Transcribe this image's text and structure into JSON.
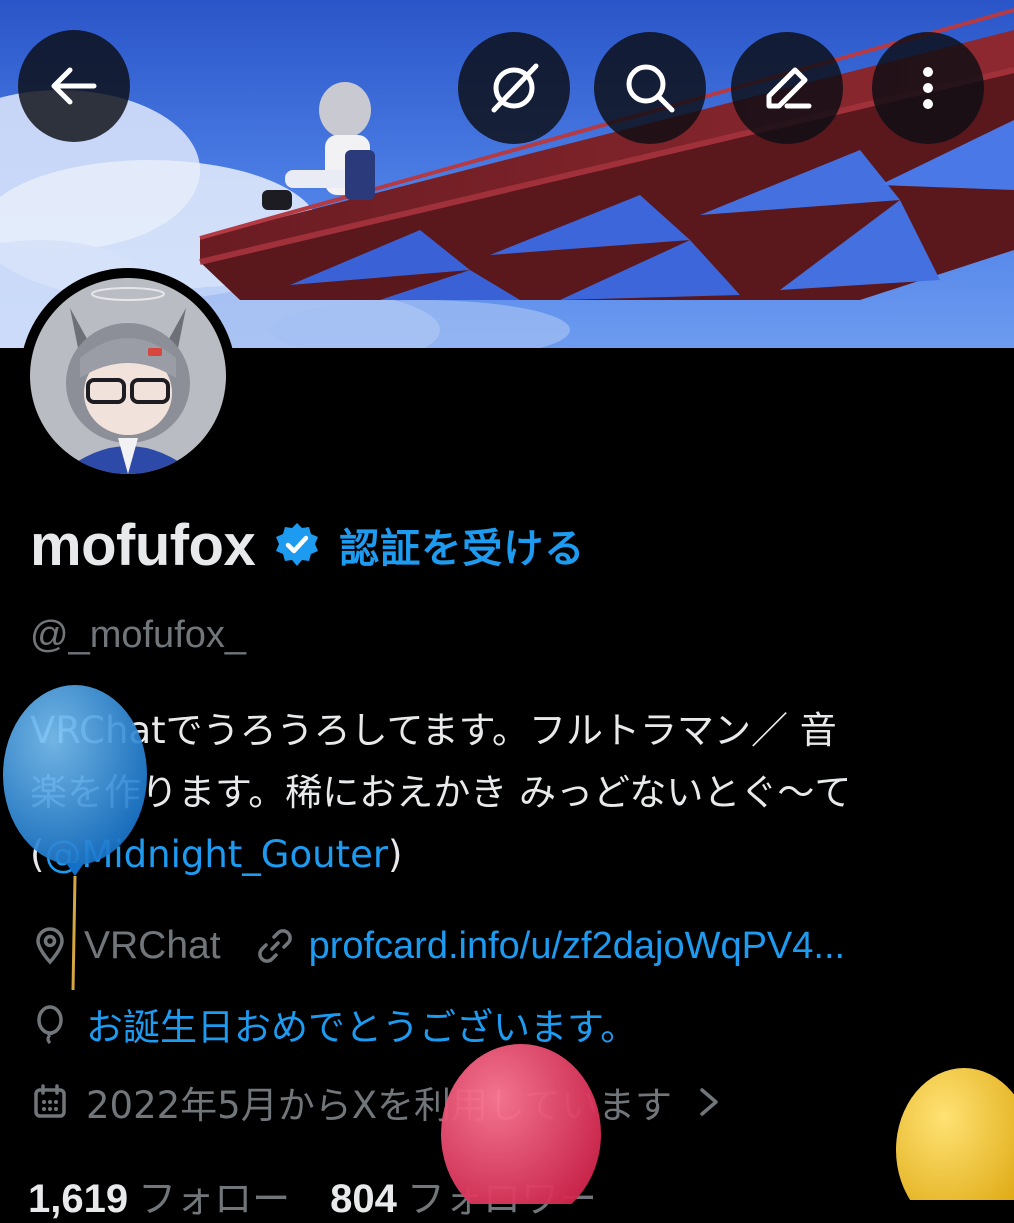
{
  "header": {
    "back_icon": "arrow-left-icon",
    "actions": [
      "grok-icon",
      "search-icon",
      "edit-icon",
      "more-vertical-icon"
    ]
  },
  "profile": {
    "display_name": "mofufox",
    "get_verified": "認証を受ける",
    "handle": "@_mofufox_",
    "bio_line1": "VRChatでうろうろしてます。フルトラマン／ 音",
    "bio_line2": "楽を作ります。稀におえかき みっどないとぐ〜て",
    "bio_open": "(",
    "bio_mention": "@Midnight_Gouter",
    "bio_close": ")",
    "location": "VRChat",
    "website": "profcard.info/u/zf2dajoWqPV4...",
    "birthday_message": "お誕生日おめでとうございます。",
    "joined": "2022年5月からXを利用しています"
  },
  "stats": {
    "following_count": "1,619",
    "following_label": "フォロー",
    "followers_count": "804",
    "followers_label": "フォロワー"
  },
  "colors": {
    "accent": "#1d9bf0",
    "muted": "#71767b",
    "text": "#e7e9ea",
    "balloon_blue": "#1e8fe0",
    "balloon_red": "#e8325a",
    "balloon_yellow": "#f2c21b"
  }
}
